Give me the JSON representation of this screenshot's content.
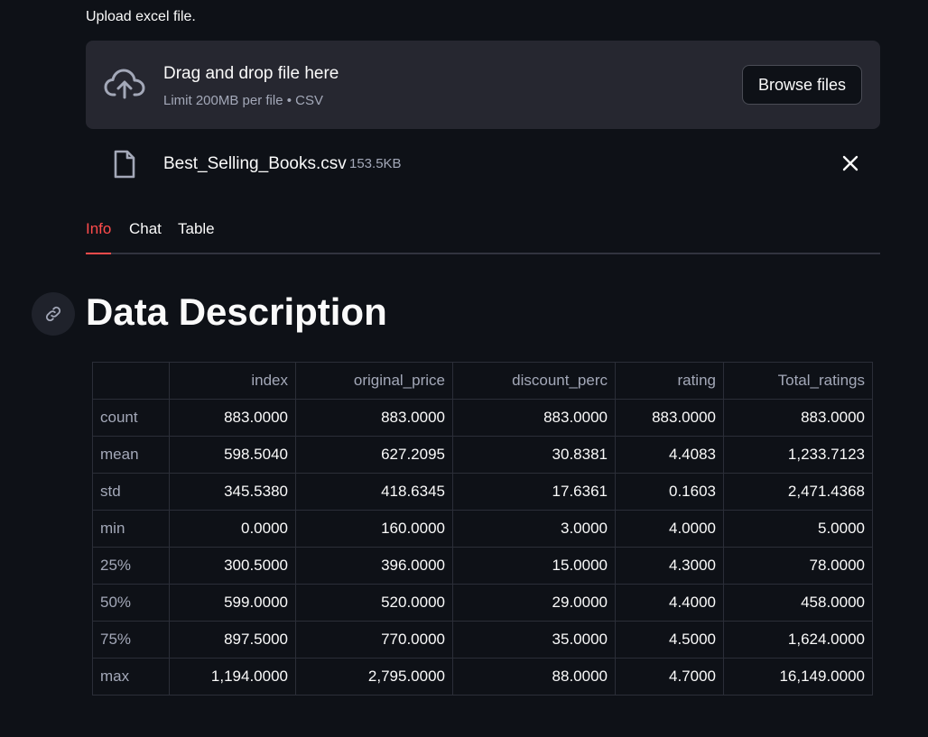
{
  "uploader": {
    "label": "Upload excel file.",
    "drop_title": "Drag and drop file here",
    "drop_subtitle": "Limit 200MB per file • CSV",
    "browse_label": "Browse files",
    "icon": "cloud-upload-icon"
  },
  "file": {
    "name": "Best_Selling_Books.csv",
    "size": "153.5KB",
    "icon": "file-icon"
  },
  "tabs": [
    {
      "label": "Info",
      "active": true
    },
    {
      "label": "Chat",
      "active": false
    },
    {
      "label": "Table",
      "active": false
    }
  ],
  "section_title": "Data Description",
  "table": {
    "columns": [
      "",
      "index",
      "original_price",
      "discount_perc",
      "rating",
      "Total_ratings"
    ],
    "rows": [
      [
        "count",
        "883.0000",
        "883.0000",
        "883.0000",
        "883.0000",
        "883.0000"
      ],
      [
        "mean",
        "598.5040",
        "627.2095",
        "30.8381",
        "4.4083",
        "1,233.7123"
      ],
      [
        "std",
        "345.5380",
        "418.6345",
        "17.6361",
        "0.1603",
        "2,471.4368"
      ],
      [
        "min",
        "0.0000",
        "160.0000",
        "3.0000",
        "4.0000",
        "5.0000"
      ],
      [
        "25%",
        "300.5000",
        "396.0000",
        "15.0000",
        "4.3000",
        "78.0000"
      ],
      [
        "50%",
        "599.0000",
        "520.0000",
        "29.0000",
        "4.4000",
        "458.0000"
      ],
      [
        "75%",
        "897.5000",
        "770.0000",
        "35.0000",
        "4.5000",
        "1,624.0000"
      ],
      [
        "max",
        "1,194.0000",
        "2,795.0000",
        "88.0000",
        "4.7000",
        "16,149.0000"
      ]
    ]
  },
  "colors": {
    "background": "#0e1117",
    "panel": "#262730",
    "accent": "#ff4b4b",
    "muted_text": "#a3a8b8"
  }
}
